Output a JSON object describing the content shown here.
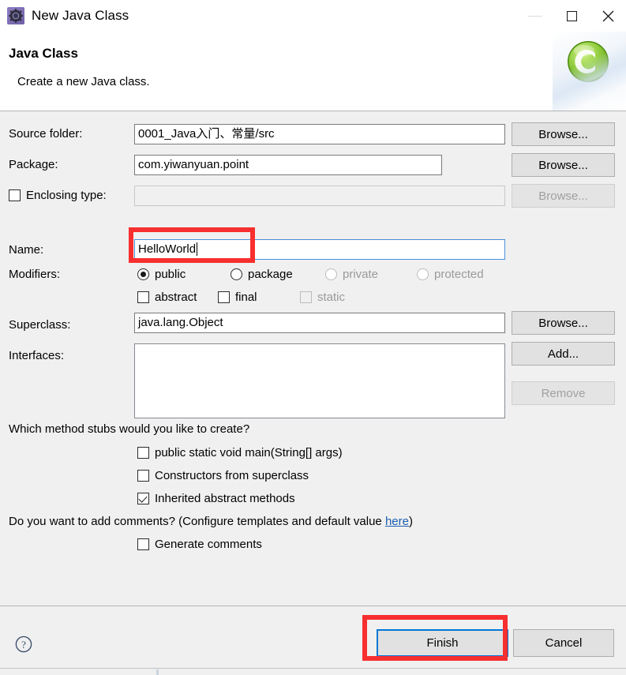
{
  "window": {
    "title": "New Java Class",
    "icon": "java-wizard-gear-icon",
    "minimize_label": "Minimize",
    "maximize_label": "Maximize",
    "close_label": "Close",
    "minimize_disabled": true
  },
  "header": {
    "title": "Java Class",
    "subtitle": "Create a new Java class.",
    "banner_icon": "green-class-c-icon"
  },
  "form": {
    "source_folder": {
      "label": "Source folder:",
      "value": "0001_Java入门、常量/src",
      "browse_label": "Browse...",
      "browse_disabled": false
    },
    "package": {
      "label": "Package:",
      "value": "com.yiwanyuan.point",
      "browse_label": "Browse...",
      "browse_disabled": false
    },
    "enclosing_type": {
      "label": "Enclosing type:",
      "checked": false,
      "value": "",
      "browse_label": "Browse...",
      "browse_disabled": true
    },
    "name": {
      "label": "Name:",
      "value": "HelloWorld",
      "focused": true
    },
    "modifiers": {
      "label": "Modifiers:",
      "access": [
        {
          "label": "public",
          "checked": true,
          "disabled": false
        },
        {
          "label": "package",
          "checked": false,
          "disabled": false
        },
        {
          "label": "private",
          "checked": false,
          "disabled": true
        },
        {
          "label": "protected",
          "checked": false,
          "disabled": true
        }
      ],
      "flags": [
        {
          "label": "abstract",
          "checked": false,
          "disabled": false
        },
        {
          "label": "final",
          "checked": false,
          "disabled": false
        },
        {
          "label": "static",
          "checked": false,
          "disabled": true
        }
      ]
    },
    "superclass": {
      "label": "Superclass:",
      "value": "java.lang.Object",
      "browse_label": "Browse..."
    },
    "interfaces": {
      "label": "Interfaces:",
      "items": [],
      "add_label": "Add...",
      "remove_label": "Remove",
      "remove_disabled": true
    },
    "method_stubs": {
      "question": "Which method stubs would you like to create?",
      "options": [
        {
          "label": "public static void main(String[] args)",
          "checked": false
        },
        {
          "label": "Constructors from superclass",
          "checked": false
        },
        {
          "label": "Inherited abstract methods",
          "checked": true
        }
      ]
    },
    "comments": {
      "question_before": "Do you want to add comments? (Configure templates and default value ",
      "link_label": "here",
      "question_after": ")",
      "generate": {
        "label": "Generate comments",
        "checked": false
      }
    }
  },
  "footer": {
    "help_icon": "help-question-icon",
    "finish_label": "Finish",
    "cancel_label": "Cancel",
    "finish_is_default": true
  },
  "annotations": {
    "accent_color": "#f82f2f",
    "boxes": [
      {
        "name": "name-field-highlight",
        "target": "name-input"
      },
      {
        "name": "finish-button-highlight",
        "target": "finish-button"
      }
    ]
  }
}
